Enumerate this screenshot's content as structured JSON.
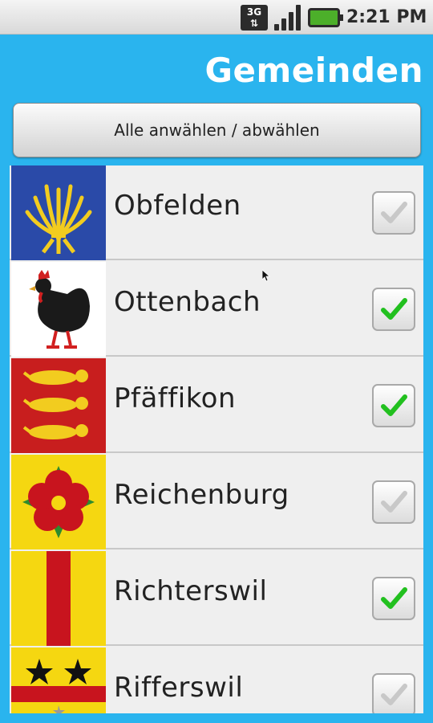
{
  "status_bar": {
    "network_label": "3G",
    "time": "2:21 PM",
    "icons": [
      "3g-icon",
      "signal-icon",
      "battery-charging-icon"
    ]
  },
  "header": {
    "title": "Gemeinden"
  },
  "toolbar": {
    "toggle_all_label": "Alle anwählen / abwählen"
  },
  "colors": {
    "accent": "#2ab4ee",
    "check_green": "#22c01f",
    "check_disabled": "#c8c8c8"
  },
  "municipalities": [
    {
      "name": "Obfelden",
      "checked": false,
      "crest_icon": "obfelden-crest-icon"
    },
    {
      "name": "Ottenbach",
      "checked": true,
      "crest_icon": "ottenbach-crest-icon"
    },
    {
      "name": "Pfäffikon",
      "checked": true,
      "crest_icon": "pfaeffikon-crest-icon"
    },
    {
      "name": "Reichenburg",
      "checked": false,
      "crest_icon": "reichenburg-crest-icon"
    },
    {
      "name": "Richterswil",
      "checked": true,
      "crest_icon": "richterswil-crest-icon"
    },
    {
      "name": "Rifferswil",
      "checked": false,
      "crest_icon": "rifferswil-crest-icon"
    }
  ]
}
